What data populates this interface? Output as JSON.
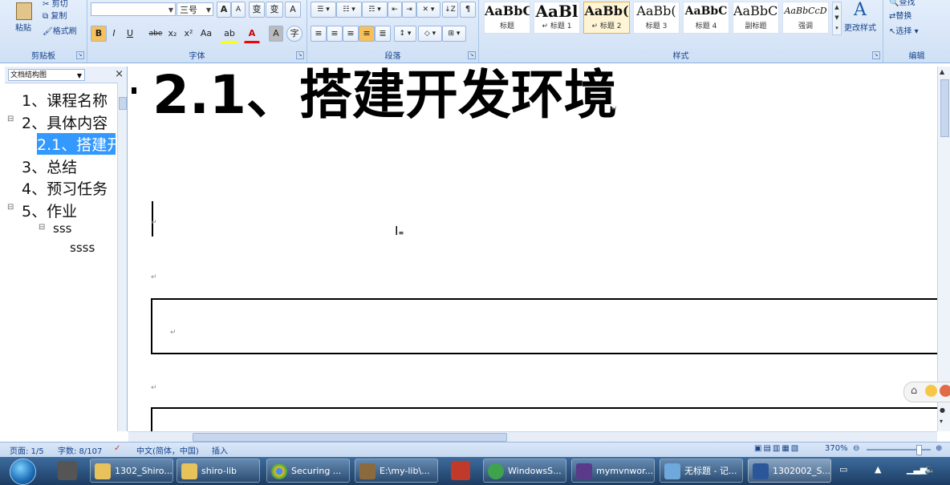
{
  "ribbon": {
    "clipboard": {
      "label": "剪贴板",
      "paste": "粘贴",
      "cut": "剪切",
      "copy": "复制",
      "format_painter": "格式刷"
    },
    "font": {
      "label": "字体",
      "font_name": "",
      "font_size": "三号",
      "bold": "B",
      "italic": "I",
      "underline": "U",
      "strike": "abe",
      "subscript": "x₂",
      "superscript": "x²",
      "change_case": "Aa",
      "grow": "A",
      "shrink": "A",
      "clear": "变",
      "char_border": "A",
      "highlight": "ab",
      "font_color": "A",
      "char_shade": "A",
      "enclose": "字"
    },
    "paragraph": {
      "label": "段落"
    },
    "styles": {
      "label": "样式",
      "items": [
        {
          "sample": "AaBbC(",
          "name": "标题"
        },
        {
          "sample": "AaBl",
          "name": "↵ 标题 1"
        },
        {
          "sample": "AaBb(",
          "name": "↵ 标题 2"
        },
        {
          "sample": "AaBb(",
          "name": "标题 3"
        },
        {
          "sample": "AaBbC",
          "name": "标题 4"
        },
        {
          "sample": "AaBbC(",
          "name": "副标题"
        },
        {
          "sample": "AaBbCcD",
          "name": "强调"
        }
      ],
      "change_styles": "更改样式"
    },
    "editing": {
      "label": "编辑",
      "find": "查找",
      "replace": "替换",
      "select": "选择"
    }
  },
  "nav": {
    "mode": "文档结构图",
    "close": "×",
    "items": [
      {
        "text": "1、课程名称"
      },
      {
        "text": "2、具体内容"
      },
      {
        "text": "2.1、搭建开"
      },
      {
        "text": "3、总结"
      },
      {
        "text": "4、预习任务"
      },
      {
        "text": "5、作业"
      },
      {
        "text": "sss"
      },
      {
        "text": "ssss"
      }
    ]
  },
  "document": {
    "heading": "2.1、搭建开发环境",
    "para_mark": "↵"
  },
  "status": {
    "page": "页面: 1/5",
    "words": "字数: 8/107",
    "language": "中文(简体，中国)",
    "mode": "插入",
    "zoom": "370%"
  },
  "taskbar": {
    "items": [
      {
        "label": "1302_Shiro...",
        "color": "#e8c25a"
      },
      {
        "label": "shiro-lib",
        "color": "#e8c25a"
      },
      {
        "label": "Securing ...",
        "color": "#4caf50"
      },
      {
        "label": "E:\\my-lib\\...",
        "color": "#8b6b3d"
      },
      {
        "label": "WindowsS...",
        "color": "#3fa34d"
      },
      {
        "label": "mymvnwor...",
        "color": "#5a3a8a"
      },
      {
        "label": "无标题 - 记...",
        "color": "#6fa8dc"
      },
      {
        "label": "1302002_S...",
        "color": "#2b579a"
      }
    ]
  }
}
